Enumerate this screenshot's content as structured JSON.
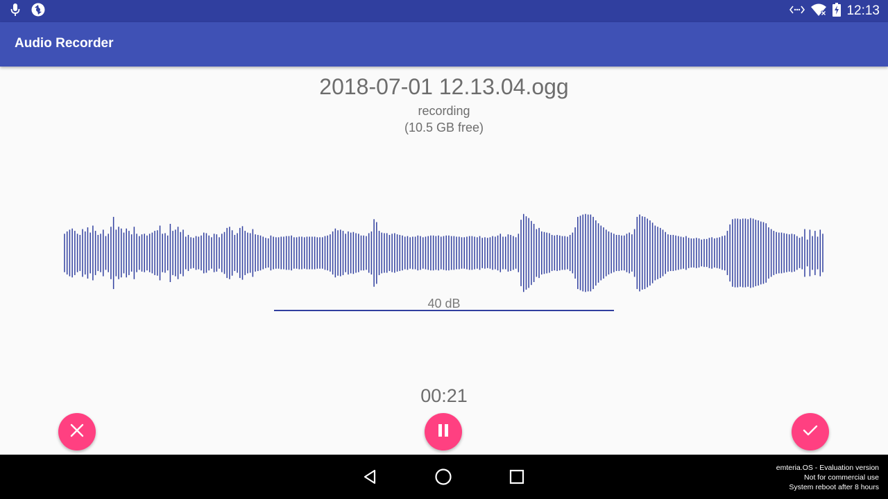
{
  "status_bar": {
    "time": "12:13",
    "left_icons": [
      "microphone-icon",
      "sync-icon"
    ],
    "right_icons": [
      "data-transfer-icon",
      "wifi-off-icon",
      "battery-charging-icon"
    ]
  },
  "app_bar": {
    "title": "Audio Recorder"
  },
  "recording": {
    "file_name": "2018-07-01 12.13.04.ogg",
    "state": "recording",
    "free_space": "(10.5 GB free)",
    "db_label": "40 dB",
    "elapsed": "00:21"
  },
  "waveform": {
    "color": "#303f9f",
    "levels": [
      0.33,
      0.37,
      0.4,
      0.42,
      0.38,
      0.33,
      0.31,
      0.41,
      0.37,
      0.44,
      0.35,
      0.47,
      0.38,
      0.31,
      0.33,
      0.4,
      0.29,
      0.33,
      0.45,
      0.62,
      0.4,
      0.45,
      0.42,
      0.35,
      0.42,
      0.38,
      0.32,
      0.45,
      0.33,
      0.29,
      0.32,
      0.33,
      0.3,
      0.33,
      0.35,
      0.38,
      0.39,
      0.47,
      0.33,
      0.34,
      0.3,
      0.5,
      0.38,
      0.4,
      0.45,
      0.36,
      0.4,
      0.28,
      0.31,
      0.27,
      0.26,
      0.29,
      0.28,
      0.3,
      0.35,
      0.34,
      0.3,
      0.27,
      0.33,
      0.32,
      0.27,
      0.33,
      0.36,
      0.43,
      0.45,
      0.39,
      0.31,
      0.34,
      0.43,
      0.46,
      0.38,
      0.35,
      0.34,
      0.41,
      0.32,
      0.31,
      0.3,
      0.28,
      0.26,
      0.25,
      0.3,
      0.28,
      0.27,
      0.27,
      0.28,
      0.28,
      0.29,
      0.29,
      0.3,
      0.27,
      0.27,
      0.28,
      0.28,
      0.27,
      0.28,
      0.28,
      0.28,
      0.28,
      0.27,
      0.27,
      0.27,
      0.29,
      0.3,
      0.32,
      0.37,
      0.42,
      0.39,
      0.4,
      0.38,
      0.33,
      0.37,
      0.35,
      0.36,
      0.34,
      0.33,
      0.3,
      0.3,
      0.29,
      0.34,
      0.37,
      0.58,
      0.53,
      0.38,
      0.35,
      0.34,
      0.34,
      0.31,
      0.33,
      0.34,
      0.32,
      0.31,
      0.3,
      0.28,
      0.29,
      0.27,
      0.28,
      0.28,
      0.3,
      0.29,
      0.27,
      0.28,
      0.29,
      0.3,
      0.3,
      0.29,
      0.3,
      0.28,
      0.29,
      0.3,
      0.3,
      0.29,
      0.29,
      0.28,
      0.28,
      0.27,
      0.27,
      0.28,
      0.29,
      0.29,
      0.28,
      0.27,
      0.29,
      0.26,
      0.27,
      0.26,
      0.27,
      0.29,
      0.28,
      0.3,
      0.33,
      0.28,
      0.28,
      0.32,
      0.31,
      0.29,
      0.27,
      0.33,
      0.57,
      0.67,
      0.63,
      0.6,
      0.55,
      0.5,
      0.41,
      0.43,
      0.37,
      0.36,
      0.35,
      0.34,
      0.31,
      0.3,
      0.31,
      0.3,
      0.29,
      0.29,
      0.28,
      0.31,
      0.35,
      0.44,
      0.62,
      0.64,
      0.66,
      0.67,
      0.66,
      0.66,
      0.62,
      0.56,
      0.51,
      0.47,
      0.44,
      0.4,
      0.37,
      0.35,
      0.33,
      0.31,
      0.31,
      0.3,
      0.3,
      0.33,
      0.35,
      0.32,
      0.41,
      0.62,
      0.66,
      0.63,
      0.62,
      0.59,
      0.56,
      0.52,
      0.47,
      0.45,
      0.43,
      0.4,
      0.36,
      0.32,
      0.31,
      0.31,
      0.3,
      0.29,
      0.28,
      0.27,
      0.29,
      0.26,
      0.25,
      0.25,
      0.26,
      0.25,
      0.23,
      0.24,
      0.24,
      0.26,
      0.27,
      0.25,
      0.26,
      0.27,
      0.29,
      0.3,
      0.38,
      0.49,
      0.58,
      0.59,
      0.59,
      0.58,
      0.59,
      0.59,
      0.58,
      0.6,
      0.59,
      0.57,
      0.56,
      0.54,
      0.53,
      0.51,
      0.44,
      0.41,
      0.38,
      0.36,
      0.35,
      0.35,
      0.34,
      0.33,
      0.32,
      0.33,
      0.32,
      0.29,
      0.26,
      0.28,
      0.41,
      0.23,
      0.4,
      0.29,
      0.38,
      0.28,
      0.4,
      0.33
    ]
  },
  "actions": {
    "cancel_icon": "close-icon",
    "pause_icon": "pause-icon",
    "done_icon": "check-icon",
    "accent_color": "#ff4081"
  },
  "nav_bar": {
    "icons": [
      "back-icon",
      "home-icon",
      "recents-icon"
    ]
  },
  "watermark": {
    "line1": "emteria.OS - Evaluation version",
    "line2": "Not for commercial use",
    "line3": "System reboot after 8 hours"
  },
  "theme": {
    "status_bar_color": "#303f9f",
    "app_bar_color": "#3f51b5",
    "text_color": "#6d6d6d"
  }
}
